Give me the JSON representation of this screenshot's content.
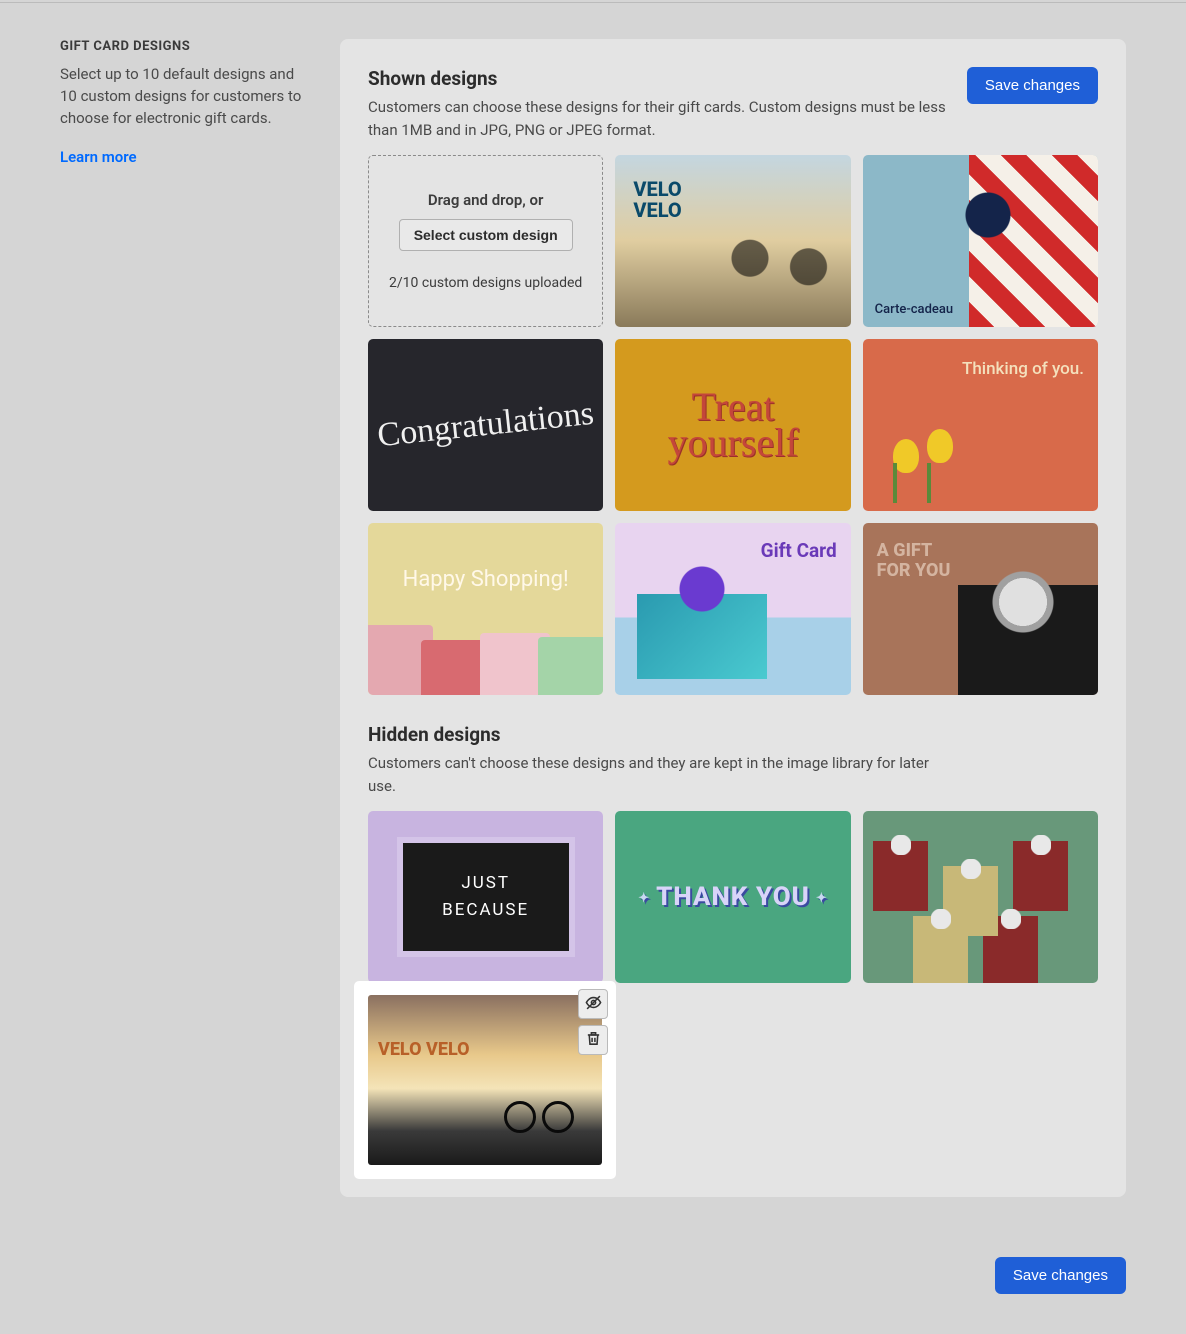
{
  "sidebar": {
    "title": "GIFT CARD DESIGNS",
    "description": "Select up to 10 default designs and 10 custom designs for customers to choose for electronic gift cards.",
    "learn_more": "Learn more"
  },
  "shown": {
    "title": "Shown designs",
    "description": "Customers can choose these designs for their gift cards. Custom designs must be less than 1MB and in JPG, PNG or JPEG format.",
    "save_label": "Save changes",
    "upload": {
      "drag_text": "Drag and drop, or",
      "button_label": "Select custom design",
      "count_text": "2/10 custom designs uploaded"
    },
    "cards": {
      "velo1_line1": "VELO",
      "velo1_line2": "VELO",
      "carte_cadeau": "Carte-cadeau",
      "congrats": "Congratulations",
      "treat_line1": "Treat",
      "treat_line2": "yourself",
      "thinking": "Thinking of you.",
      "shopping": "Happy Shopping!",
      "giftcard": "Gift Card",
      "giftforyou_line1": "A GIFT",
      "giftforyou_line2": "FOR YOU"
    }
  },
  "hidden": {
    "title": "Hidden designs",
    "description": "Customers can't choose these designs and they are kept in the image library for later use.",
    "cards": {
      "just_because_line1": "JUST",
      "just_because_line2": "BECAUSE",
      "thank_you": "THANK YOU",
      "velo2": "VELO VELO"
    }
  },
  "footer": {
    "save_label": "Save changes"
  }
}
